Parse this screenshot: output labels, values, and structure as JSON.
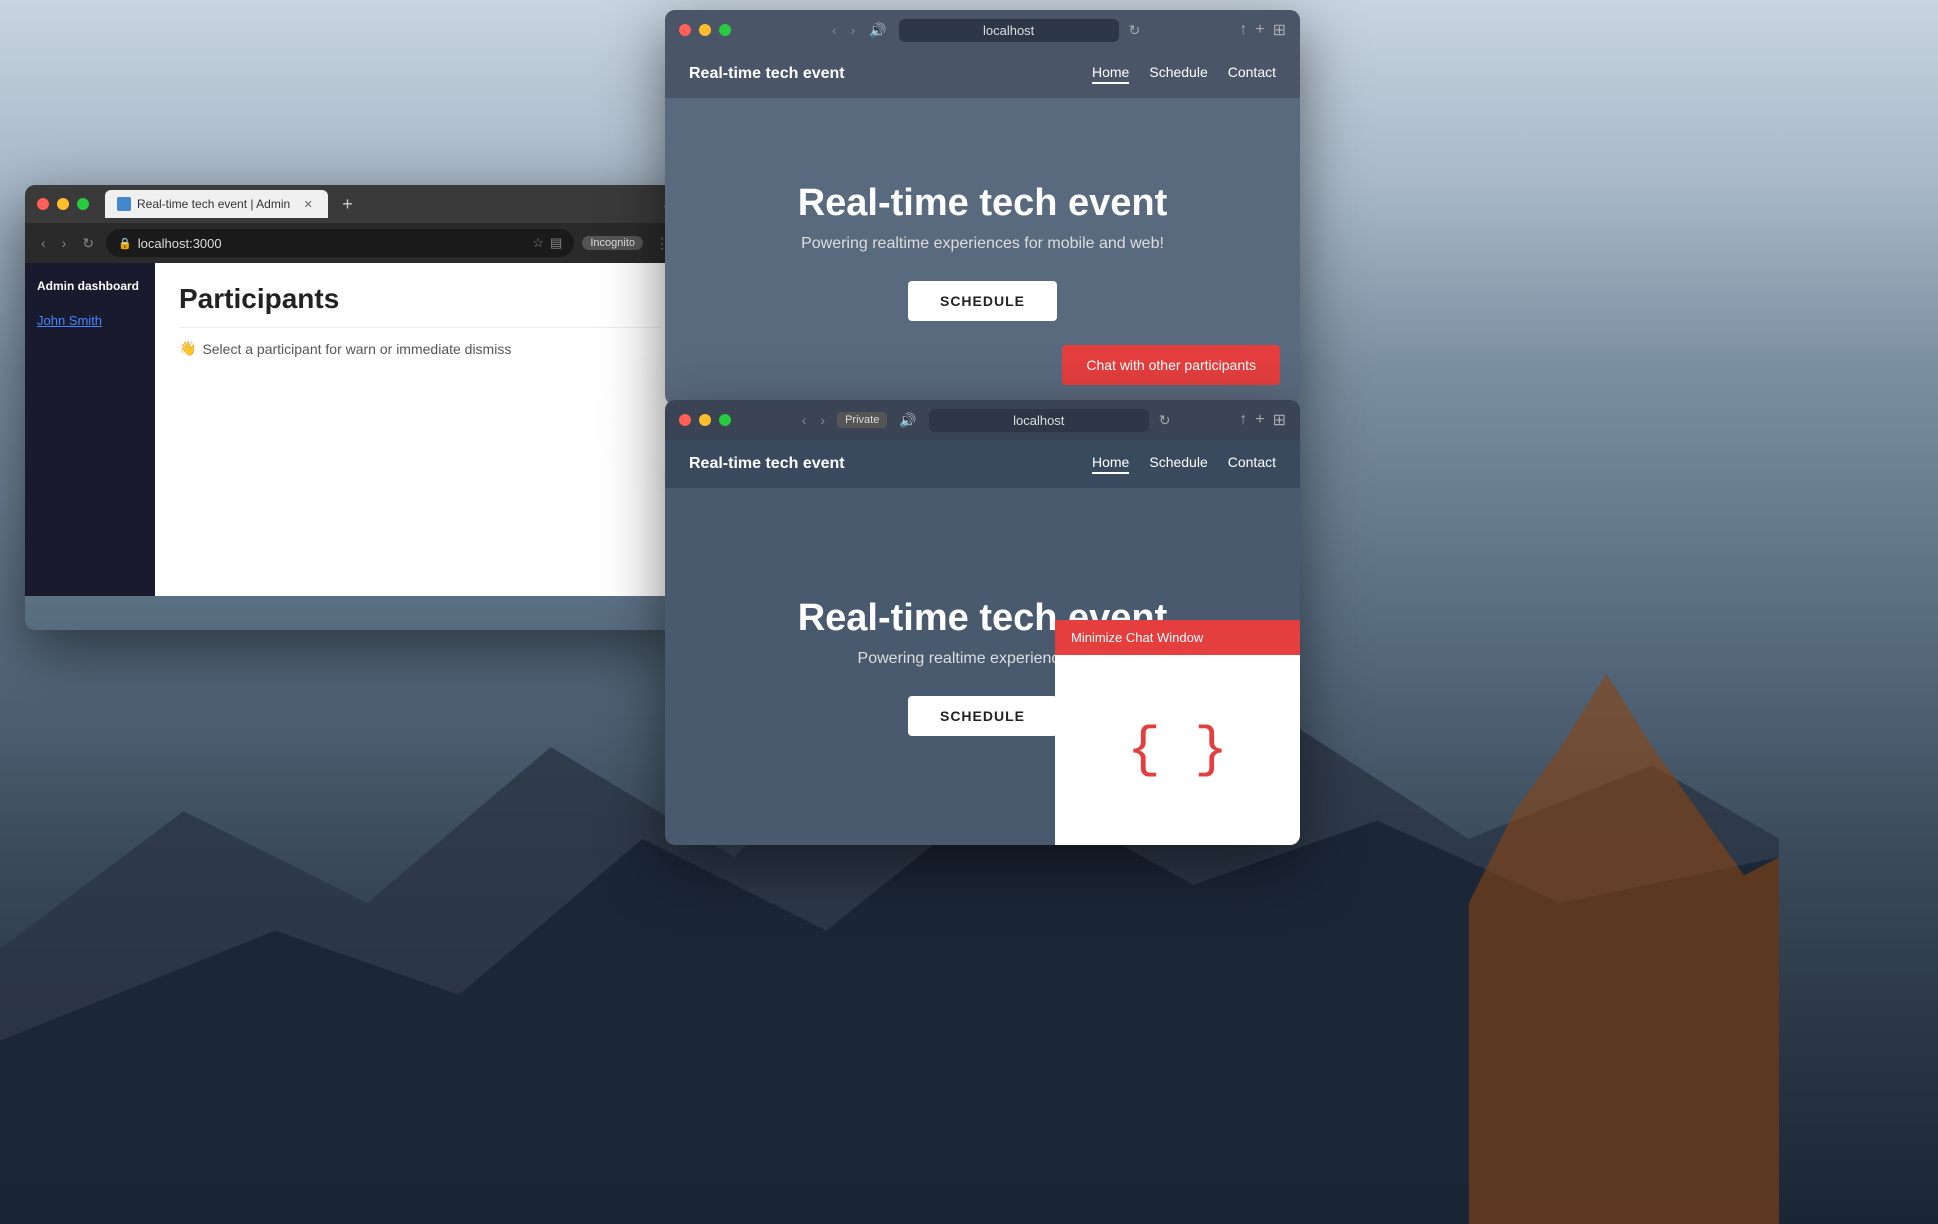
{
  "desktop": {
    "background_desc": "Mountain landscape"
  },
  "admin_browser": {
    "tab_title": "Real-time tech event | Admin",
    "address": "localhost:3000",
    "header": "Admin dashboard",
    "sidebar": {
      "user": "John Smith"
    },
    "main": {
      "title": "Participants",
      "hint": "Select a participant for warn or immediate dismiss",
      "hint_emoji": "👋"
    }
  },
  "event_browser_1": {
    "url": "localhost",
    "nav": {
      "brand": "Real-time tech event",
      "links": [
        "Home",
        "Schedule",
        "Contact"
      ],
      "active": "Home"
    },
    "hero": {
      "title": "Real-time tech event",
      "subtitle": "Powering realtime experiences for mobile and web!",
      "schedule_btn": "SCHEDULE"
    },
    "chat_btn": "Chat with other participants"
  },
  "event_browser_2": {
    "url": "localhost",
    "badge": "Private",
    "nav": {
      "brand": "Real-time tech event",
      "links": [
        "Home",
        "Schedule",
        "Contact"
      ],
      "active": "Home"
    },
    "hero": {
      "title": "Real-time tech event",
      "subtitle": "Powering realtime experiences fo...",
      "schedule_btn": "SCHEDULE"
    },
    "chat_window": {
      "header": "Minimize Chat Window",
      "logo": "{ }"
    }
  },
  "icons": {
    "close": "✕",
    "back": "‹",
    "forward": "›",
    "refresh": "↻",
    "share": "↑",
    "add_tab": "+",
    "grid": "⊞",
    "sound": "🔊"
  }
}
